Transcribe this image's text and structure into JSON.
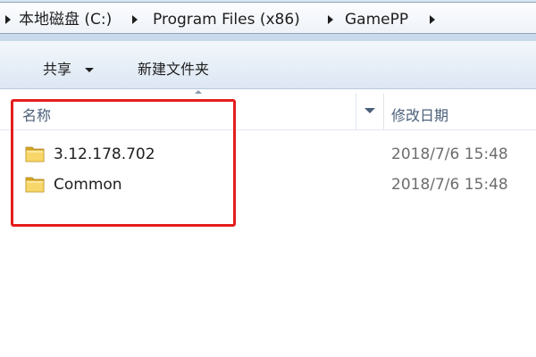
{
  "breadcrumb": {
    "segments": [
      {
        "label": "本地磁盘 (C:)"
      },
      {
        "label": "Program Files (x86)"
      },
      {
        "label": "GamePP"
      }
    ]
  },
  "toolbar": {
    "share_label": "共享",
    "new_folder_label": "新建文件夹"
  },
  "columns": {
    "name": "名称",
    "date_modified": "修改日期"
  },
  "files": [
    {
      "name": "3.12.178.702",
      "date": "2018/7/6 15:48",
      "icon": "folder-icon"
    },
    {
      "name": "Common",
      "date": "2018/7/6 15:48",
      "icon": "folder-icon"
    }
  ],
  "annotation": {
    "highlight_color": "#e41d1d"
  }
}
